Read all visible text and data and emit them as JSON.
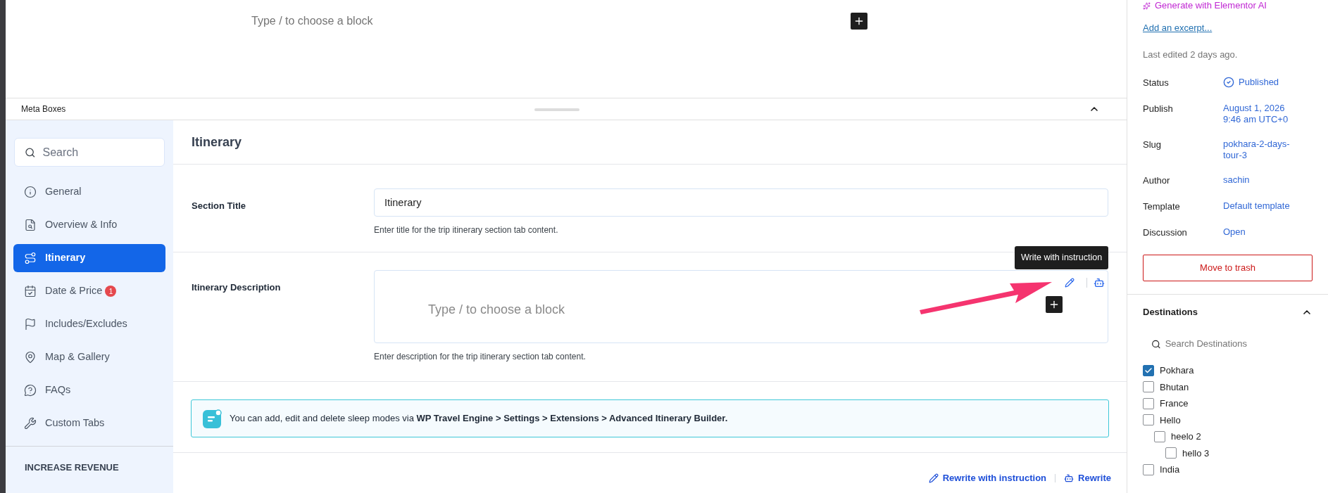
{
  "editor": {
    "placeholder": "Type / to choose a block"
  },
  "meta_boxes": {
    "title": "Meta Boxes",
    "expanded": true
  },
  "sidebar": {
    "search_placeholder": "Search",
    "items": [
      {
        "label": "General",
        "selected": false
      },
      {
        "label": "Overview & Info",
        "selected": false
      },
      {
        "label": "Itinerary",
        "selected": true
      },
      {
        "label": "Date & Price",
        "selected": false,
        "badge": "1"
      },
      {
        "label": "Includes/Excludes",
        "selected": false
      },
      {
        "label": "Map & Gallery",
        "selected": false
      },
      {
        "label": "FAQs",
        "selected": false
      },
      {
        "label": "Custom Tabs",
        "selected": false
      }
    ],
    "section_heading": "INCREASE REVENUE"
  },
  "panel": {
    "title": "Itinerary",
    "fields": [
      {
        "kind": "input",
        "label": "Section Title",
        "value": "Itinerary",
        "help": "Enter title for the trip itinerary section tab content."
      },
      {
        "kind": "editor",
        "label": "Itinerary Description",
        "placeholder": "Type / to choose a block",
        "help": "Enter description for the trip itinerary section tab content.",
        "tooltip": "Write with instruction"
      }
    ],
    "notice": "You can add, edit and delete sleep modes via **WP Travel Engine > Settings > Extensions > Advanced Itinerary Builder.**",
    "actions": [
      "Rewrite with instruction",
      "Rewrite"
    ]
  },
  "post_settings": {
    "ai_link": "Generate with Elementor AI",
    "excerpt_link": "Add an excerpt...",
    "last_edited": "Last edited 2 days ago.",
    "rows": [
      {
        "label": "Status",
        "value": "Published",
        "kind": "status"
      },
      {
        "label": "Publish",
        "value": "August 1, 2026 9:46 am UTC+0",
        "kind": "text"
      },
      {
        "label": "Slug",
        "value": "pokhara-2-days-tour-3",
        "kind": "text"
      },
      {
        "label": "Author",
        "value": "sachin",
        "kind": "text"
      },
      {
        "label": "Template",
        "value": "Default template",
        "kind": "text"
      },
      {
        "label": "Discussion",
        "value": "Open",
        "kind": "text"
      }
    ],
    "trash_button": "Move to trash"
  },
  "destinations": {
    "title": "Destinations",
    "expanded": true,
    "search_placeholder": "Search Destinations",
    "items": [
      {
        "label": "Pokhara",
        "checked": true
      },
      {
        "label": "Bhutan",
        "checked": false
      },
      {
        "label": "France",
        "checked": false
      },
      {
        "label": "Hello",
        "checked": false,
        "children": [
          {
            "label": "heelo 2",
            "checked": false,
            "children": [
              {
                "label": "hello 3",
                "checked": false
              }
            ]
          }
        ]
      },
      {
        "label": "India",
        "checked": false
      }
    ]
  }
}
